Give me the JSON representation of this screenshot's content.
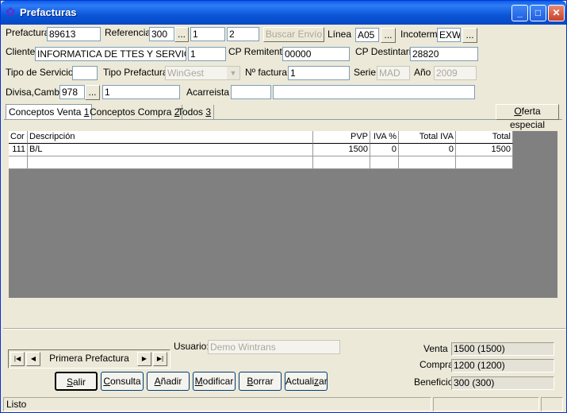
{
  "window": {
    "title": "Prefacturas"
  },
  "header": {
    "prefactura_label": "Prefactura",
    "prefactura": "89613",
    "referencia_label": "Referencia",
    "ref1": "300",
    "ref2": "1",
    "ref3": "2",
    "buscar_envio": "Buscar Envío",
    "linea_label": "Línea",
    "linea": "A05",
    "incoterm_label": "Incoterm",
    "incoterm": "EXW",
    "cliente_label": "Cliente",
    "cliente": "INFORMATICA DE TTES Y SERVICIO",
    "cliente_code": "1",
    "cp_remitente_label": "CP Remitente",
    "cp_remitente": "00000",
    "cp_destinatario_label": "CP Destintario",
    "cp_destinatario": "28820",
    "tipo_servicio_label": "Tipo de Servicio",
    "tipo_servicio": "",
    "tipo_prefactura_label": "Tipo Prefactura",
    "tipo_prefactura": "WinGest",
    "nfactura_label": "Nº factura",
    "nfactura": "1",
    "serie_label": "Serie",
    "serie": "MAD",
    "anio_label": "Año",
    "anio": "2009",
    "divisa_label": "Divisa,Cambio",
    "divisa": "978",
    "cambio": "1",
    "acarreista_label": "Acarreista",
    "acarreista_code": "",
    "acarreista_name": "",
    "ellipsis": "..."
  },
  "tabs": [
    {
      "label": "Conceptos Venta ",
      "key": "1"
    },
    {
      "label": "Conceptos Compra ",
      "key": "2"
    },
    {
      "label": "Todos ",
      "key": "3"
    }
  ],
  "oferta_especial": {
    "prefix": "",
    "key": "O",
    "rest": "ferta especial"
  },
  "grid": {
    "columns": [
      "Cor",
      "Descripción",
      "PVP",
      "IVA %",
      "Total IVA",
      "Total"
    ],
    "rows": [
      [
        "111",
        "B/L",
        "1500",
        "0",
        "0",
        "1500"
      ]
    ]
  },
  "usuario_label": "Usuario:",
  "usuario": "Demo Wintrans",
  "nav": {
    "label": "Primera Prefactura"
  },
  "buttons": {
    "salir": {
      "key": "S",
      "rest": "alir"
    },
    "consulta": {
      "key": "C",
      "rest": "onsulta"
    },
    "anadir": {
      "key": "A",
      "rest": "ñadir"
    },
    "modificar": {
      "key": "M",
      "rest": "odificar"
    },
    "borrar": {
      "key": "B",
      "rest": "orrar"
    },
    "actualizar": {
      "pre": "Actuali",
      "key": "z",
      "rest": "ar"
    }
  },
  "summary": {
    "venta_label": "Venta",
    "venta": "1500  (1500)",
    "compra_label": "Compra",
    "compra": "1200  (1200)",
    "beneficio_label": "Beneficio",
    "beneficio": "300  (300)"
  },
  "status": {
    "text": "Listo"
  },
  "colors": {
    "title_bar": "#0a56d8",
    "grid_background": "#808080",
    "window_face": "#ece9d8"
  }
}
